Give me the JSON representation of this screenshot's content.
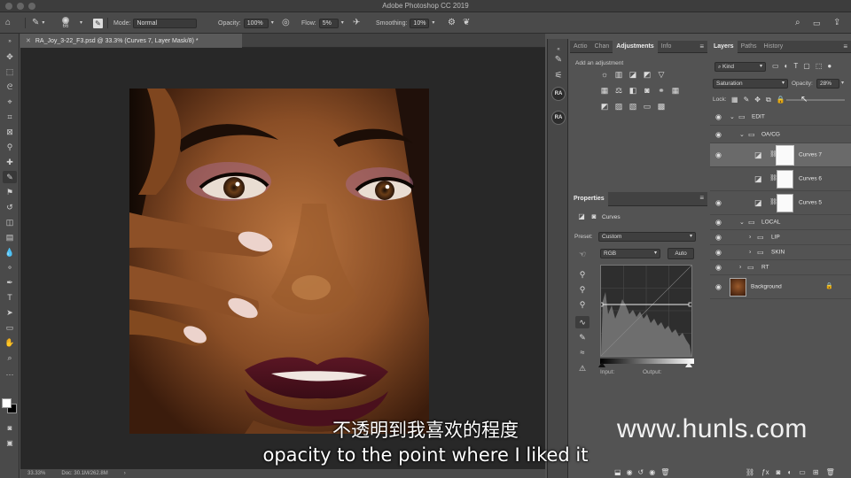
{
  "app": {
    "title": "Adobe Photoshop CC 2019"
  },
  "options_bar": {
    "brush_size": "66",
    "mode_label": "Mode:",
    "mode_value": "Normal",
    "opacity_label": "Opacity:",
    "opacity_value": "100%",
    "flow_label": "Flow:",
    "flow_value": "5%",
    "smoothing_label": "Smoothing:",
    "smoothing_value": "10%"
  },
  "document": {
    "tab_title": "RA_Joy_3-22_F3.psd @ 33.3% (Curves 7, Layer Mask/8) *",
    "zoom": "33.33%",
    "doc_size": "Doc: 30.1M/262.8M"
  },
  "dock": {
    "ra1": "RA",
    "ra2": "RA"
  },
  "adjustments_panel": {
    "tabs": [
      "Actio",
      "Chan",
      "Adjustments",
      "Info"
    ],
    "active_tab": "Adjustments",
    "hint": "Add an adjustment"
  },
  "properties_panel": {
    "title": "Properties",
    "type_label": "Curves",
    "preset_label": "Preset:",
    "preset_value": "Custom",
    "channel_value": "RGB",
    "auto_label": "Auto",
    "input_label": "Input:",
    "output_label": "Output:"
  },
  "layers_panel": {
    "tabs": [
      "Layers",
      "Paths",
      "History"
    ],
    "active_tab": "Layers",
    "filter_value": "Kind",
    "blend_value": "Saturation",
    "opacity_label": "Opacity:",
    "opacity_value": "28%",
    "lock_label": "Lock:",
    "layers": [
      {
        "name": "EDIT",
        "kind": "group"
      },
      {
        "name": "OA/CG",
        "kind": "group"
      },
      {
        "name": "Curves 7",
        "kind": "curves",
        "selected": true
      },
      {
        "name": "Curves 6",
        "kind": "curves"
      },
      {
        "name": "Curves 5",
        "kind": "curves"
      },
      {
        "name": "LOCAL",
        "kind": "group"
      },
      {
        "name": "LIP",
        "kind": "group"
      },
      {
        "name": "SKIN",
        "kind": "group"
      },
      {
        "name": "RT",
        "kind": "group"
      },
      {
        "name": "Background",
        "kind": "image"
      }
    ]
  },
  "subtitles": {
    "chinese": "不透明到我喜欢的程度",
    "english": "opacity to the point where I liked it"
  },
  "watermark": "www.hunls.com",
  "colors": {
    "ui_dark": "#535353",
    "canvas_bg": "#282828",
    "selected_row": "#6a6a6a",
    "foreground_swatch": "#ffffff",
    "background_swatch": "#000000"
  }
}
